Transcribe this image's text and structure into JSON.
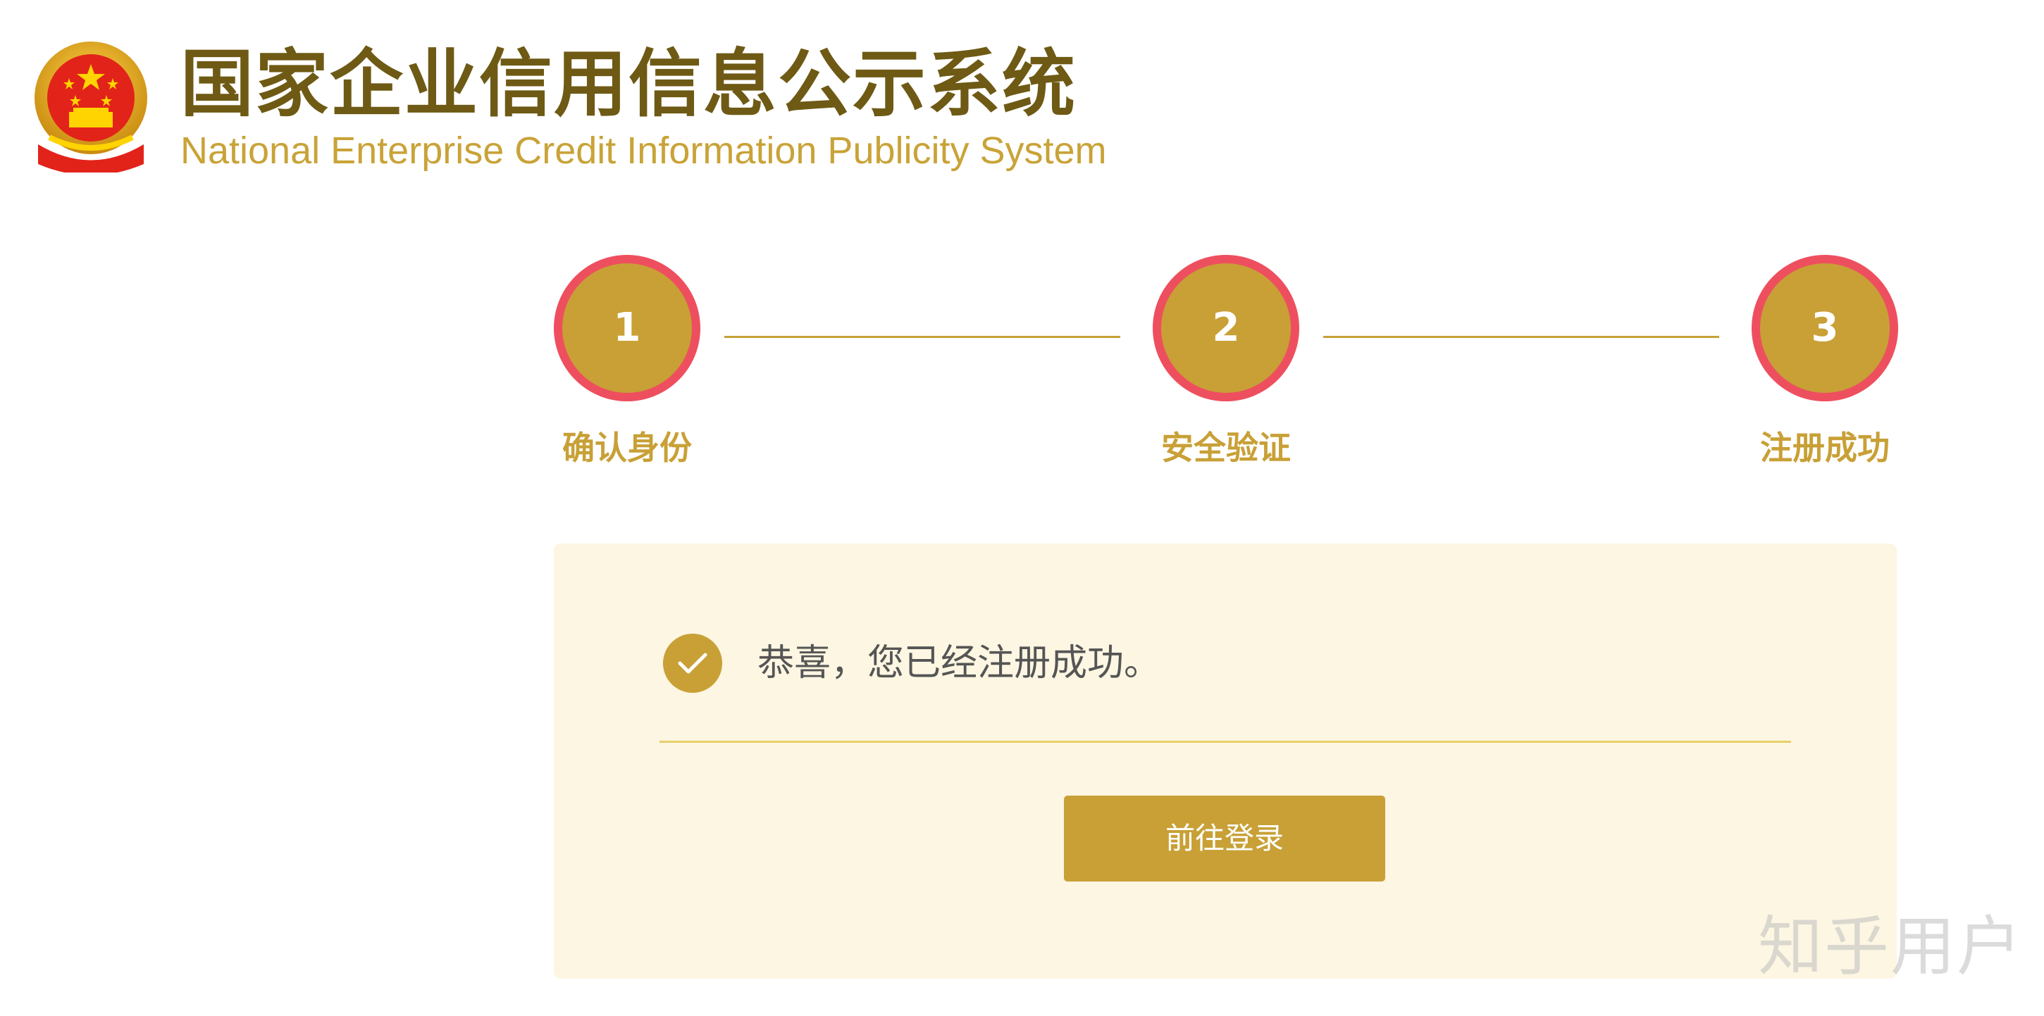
{
  "header": {
    "logo_icon": "national-emblem-icon",
    "title_cn": "国家企业信用信息公示系统",
    "title_en": "National Enterprise Credit Information Publicity System"
  },
  "steps": [
    {
      "number": "1",
      "label": "确认身份"
    },
    {
      "number": "2",
      "label": "安全验证"
    },
    {
      "number": "3",
      "label": "注册成功"
    }
  ],
  "result": {
    "icon": "check-circle-icon",
    "message": "恭喜，您已经注册成功。",
    "button_label": "前往登录"
  },
  "watermark": {
    "text": "知乎用户"
  },
  "colors": {
    "gold": "#c8a036",
    "step_ring": "#ee4f5f",
    "panel_bg": "#fcf6e2",
    "title_dark_gold": "#6e5a14",
    "divider": "#e8cf6a"
  }
}
